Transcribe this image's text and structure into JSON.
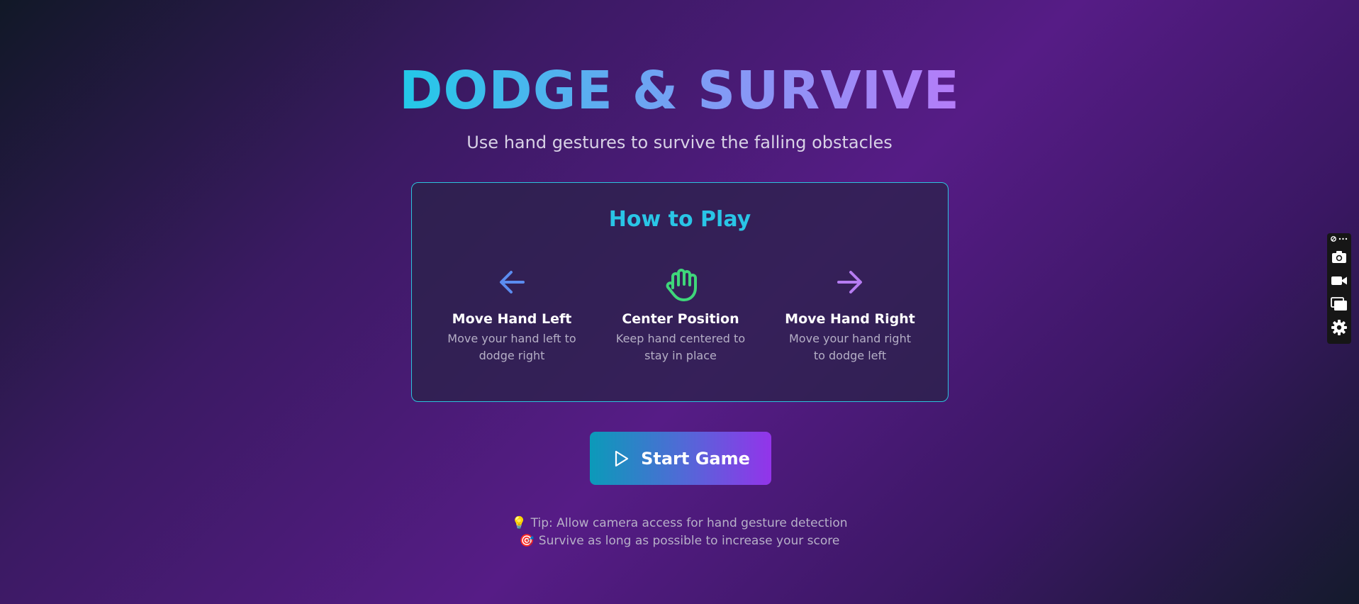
{
  "title": "DODGE & SURVIVE",
  "subtitle": "Use hand gestures to survive the falling obstacles",
  "how_to_play": {
    "heading": "How to Play",
    "instructions": [
      {
        "icon": "arrow-left-icon",
        "label": "Move Hand Left",
        "description": "Move your hand left to dodge right",
        "color": "#5b8cf0"
      },
      {
        "icon": "hand-icon",
        "label": "Center Position",
        "description": "Keep hand centered to stay in place",
        "color": "#3fd67a"
      },
      {
        "icon": "arrow-right-icon",
        "label": "Move Hand Right",
        "description": "Move your hand right to dodge left",
        "color": "#b67cf2"
      }
    ]
  },
  "start_button": {
    "icon": "play-icon",
    "label": "Start Game"
  },
  "tips": [
    {
      "icon": "💡",
      "text": "Tip: Allow camera access for hand gesture detection"
    },
    {
      "icon": "🎯",
      "text": "Survive as long as possible to increase your score"
    }
  ],
  "side_toolbar": {
    "items": [
      "more-options-icon",
      "camera-icon",
      "video-icon",
      "window-icon",
      "settings-icon"
    ]
  },
  "colors": {
    "title_gradient_start": "#22c9e8",
    "title_gradient_end": "#b57cf8",
    "accent_cyan": "#29c5e6",
    "button_gradient_start": "#0b9ab9",
    "button_gradient_end": "#9334ea"
  }
}
